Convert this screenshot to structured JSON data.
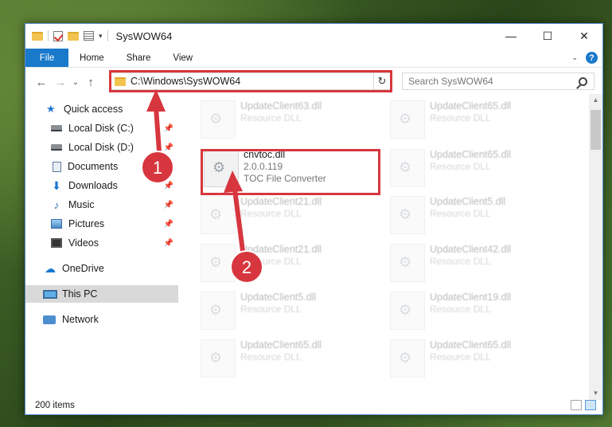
{
  "window": {
    "title": "SysWOW64"
  },
  "ribbon": {
    "tabs": [
      "File",
      "Home",
      "Share",
      "View"
    ],
    "help": "?"
  },
  "nav": {
    "back": "←",
    "forward": "→",
    "dropdown": "⌄",
    "up": "↑"
  },
  "address": {
    "path": "C:\\Windows\\SysWOW64",
    "dropdown": "⌄",
    "refresh": "↻"
  },
  "search": {
    "placeholder": "Search SysWOW64"
  },
  "sidebar": {
    "items": [
      {
        "label": "Quick access"
      },
      {
        "label": "Local Disk (C:)"
      },
      {
        "label": "Local Disk (D:)"
      },
      {
        "label": "Documents"
      },
      {
        "label": "Downloads"
      },
      {
        "label": "Music"
      },
      {
        "label": "Pictures"
      },
      {
        "label": "Videos"
      },
      {
        "label": "OneDrive"
      },
      {
        "label": "This PC"
      },
      {
        "label": "Network"
      }
    ]
  },
  "files": [
    {
      "name": "UpdateClient63.dll",
      "sub": "Resource DLL"
    },
    {
      "name": "UpdateClient65.dll",
      "sub": "Resource DLL"
    },
    {
      "name": "cnvtoc.dll",
      "version": "2.0.0.119",
      "description": "TOC File Converter"
    },
    {
      "name": "UpdateClient65.dll",
      "sub": "Resource DLL"
    },
    {
      "name": "UpdateClient21.dll",
      "sub": "Resource DLL"
    },
    {
      "name": "UpdateClient5.dll",
      "sub": "Resource DLL"
    },
    {
      "name": "UpdateClient21.dll",
      "sub": "Resource DLL"
    },
    {
      "name": "UpdateClient42.dll",
      "sub": "Resource DLL"
    },
    {
      "name": "UpdateClient5.dll",
      "sub": "Resource DLL"
    },
    {
      "name": "UpdateClient19.dll",
      "sub": "Resource DLL"
    },
    {
      "name": "UpdateClient65.dll",
      "sub": "Resource DLL"
    },
    {
      "name": "UpdateClient65.dll",
      "sub": "Resource DLL"
    }
  ],
  "status": {
    "count": "200 items"
  },
  "annotations": {
    "badge1": "1",
    "badge2": "2",
    "color": "#d7363e"
  }
}
